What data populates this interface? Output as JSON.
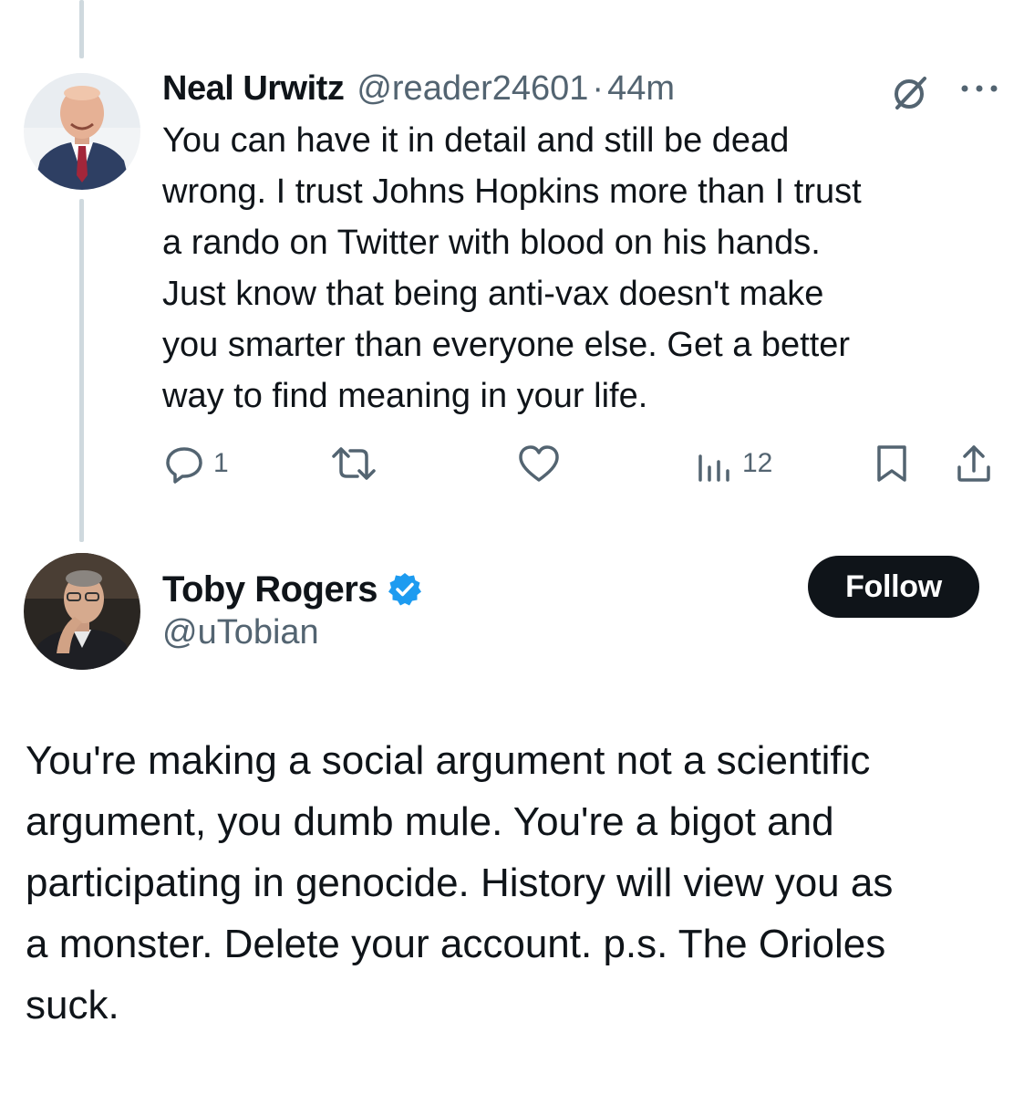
{
  "reply": {
    "name": "Neal Urwitz",
    "handle": "@reader24601",
    "separator": "·",
    "time": "44m",
    "text_lines": [
      "You can have it in detail and still be dead",
      "wrong. I trust Johns Hopkins more than I trust",
      "a rando on Twitter with blood on his hands.",
      "Just know that being anti-vax doesn't make",
      "you smarter than everyone else. Get a better",
      "way to find meaning in your life."
    ],
    "actions": {
      "reply_count": "1",
      "repost_count": "",
      "like_count": "",
      "views_count": "12"
    },
    "icons": [
      "grok-icon",
      "more-icon",
      "reply-icon",
      "repost-icon",
      "like-icon",
      "views-icon",
      "bookmark-icon",
      "share-icon"
    ]
  },
  "tweet": {
    "name": "Toby Rogers",
    "handle": "@uTobian",
    "verified": true,
    "follow_label": "Follow",
    "text_lines": [
      "You're making a social argument not a scientific",
      "argument, you dumb mule. You're a bigot and",
      "participating in genocide. History will view you as",
      "a monster. Delete your account. p.s. The Orioles",
      "suck."
    ]
  },
  "colors": {
    "text": "#0f1419",
    "secondary": "#536471",
    "thread_line": "#cfd9de",
    "verified": "#1d9bf0",
    "follow_bg": "#0f1419"
  }
}
